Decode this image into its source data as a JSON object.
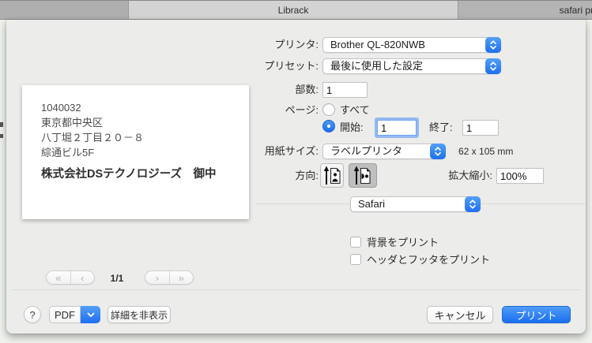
{
  "tabbar": {
    "active_tab": "Librack",
    "right_tab": "safari pr"
  },
  "print_dialog": {
    "printer": {
      "label": "プリンタ:",
      "value": "Brother QL-820NWB"
    },
    "preset": {
      "label": "プリセット:",
      "value": "最後に使用した設定"
    },
    "copies": {
      "label": "部数:",
      "value": "1"
    },
    "pages": {
      "label": "ページ:",
      "all_label": "すべて",
      "start_label": "開始:",
      "start_value": "1",
      "end_label": "終了:",
      "end_value": "1",
      "selected": "range"
    },
    "paper_size": {
      "label": "用紙サイズ:",
      "value": "ラベルプリンタ",
      "dimensions": "62 x 105 mm"
    },
    "orientation": {
      "label": "方向:",
      "selected": "landscape"
    },
    "scale": {
      "label": "拡大縮小:",
      "value": "100%"
    },
    "app_options": {
      "value": "Safari"
    },
    "options": [
      {
        "label": "背景をプリント",
        "checked": false
      },
      {
        "label": "ヘッダとフッタをプリント",
        "checked": false
      }
    ],
    "preview": {
      "address_lines": [
        "1040032",
        "東京都中央区",
        "八丁堀２丁目２０－８",
        "綜通ビル5F"
      ],
      "recipient": "株式会社DSテクノロジーズ　御中"
    },
    "pagination": {
      "page_indicator": "1/1",
      "first_icon": "«",
      "prev_icon": "‹",
      "next_icon": "›",
      "last_icon": "»"
    },
    "footer": {
      "help": "?",
      "pdf": "PDF",
      "details": "詳細を非表示",
      "cancel": "キャンセル",
      "print": "プリント"
    }
  },
  "colors": {
    "accent_blue": "#1f6ef0",
    "sheet_bg": "#ececea",
    "tab_active_bg": "#d3d3d3",
    "tab_inactive_bg": "#b2b2b2"
  }
}
